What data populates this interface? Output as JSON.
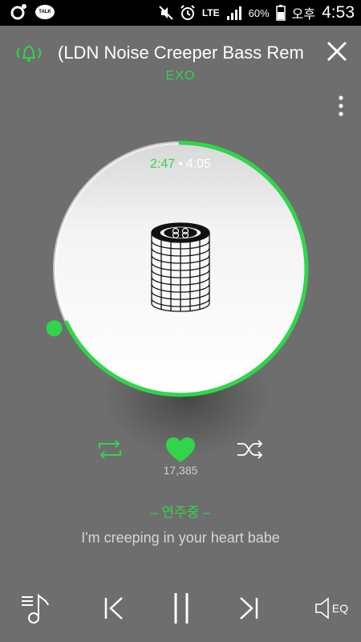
{
  "status_bar": {
    "talk_badge": "TALK",
    "network": "LTE",
    "battery": "60%",
    "ampm": "오후",
    "clock": "4:53"
  },
  "header": {
    "song_title": "(LDN Noise Creeper Bass Rem",
    "artist": "EXO"
  },
  "player": {
    "elapsed": "2:47",
    "separator": "•",
    "total": "4:05",
    "progress": 0.68
  },
  "controls": {
    "like_count": "17,385"
  },
  "lyrics": {
    "header": "– 연주중 –",
    "line": "I'm creeping in your heart babe"
  },
  "bottom_bar": {
    "eq_label": "EQ"
  },
  "colors": {
    "accent": "#2fd64a",
    "background": "#6e6e6e"
  }
}
